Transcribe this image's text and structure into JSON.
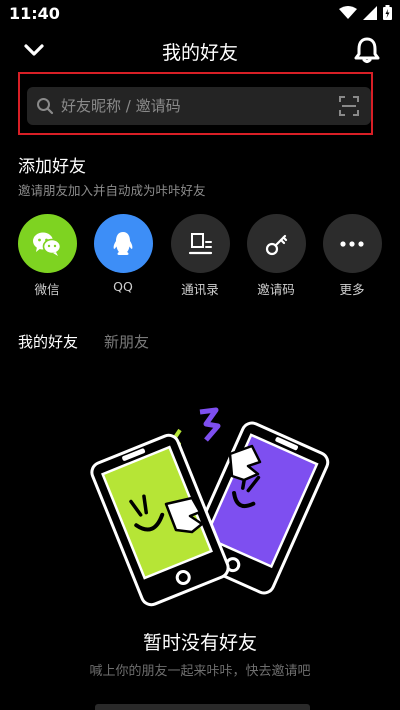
{
  "status_bar": {
    "time": "11:40"
  },
  "nav": {
    "title": "我的好友"
  },
  "search": {
    "placeholder": "好友昵称 / 邀请码"
  },
  "add_friends": {
    "title": "添加好友",
    "subtitle": "邀请朋友加入并自动成为咔咔好友",
    "options": [
      {
        "label": "微信",
        "icon": "wechat-icon",
        "color": "#7ed321"
      },
      {
        "label": "QQ",
        "icon": "qq-icon",
        "color": "#3d8ef7"
      },
      {
        "label": "通讯录",
        "icon": "contacts-icon",
        "color": "#2c2c2c"
      },
      {
        "label": "邀请码",
        "icon": "key-icon",
        "color": "#2c2c2c"
      },
      {
        "label": "更多",
        "icon": "more-icon",
        "color": "#2c2c2c"
      }
    ]
  },
  "tabs": [
    {
      "label": "我的好友",
      "active": true
    },
    {
      "label": "新朋友",
      "active": false
    }
  ],
  "empty_state": {
    "title": "暂时没有好友",
    "subtitle": "喊上你的朋友一起来咔咔，快去邀请吧"
  },
  "colors": {
    "accent_green": "#b6e536",
    "accent_purple": "#7e4ff0",
    "highlight_border": "#d81f26"
  }
}
